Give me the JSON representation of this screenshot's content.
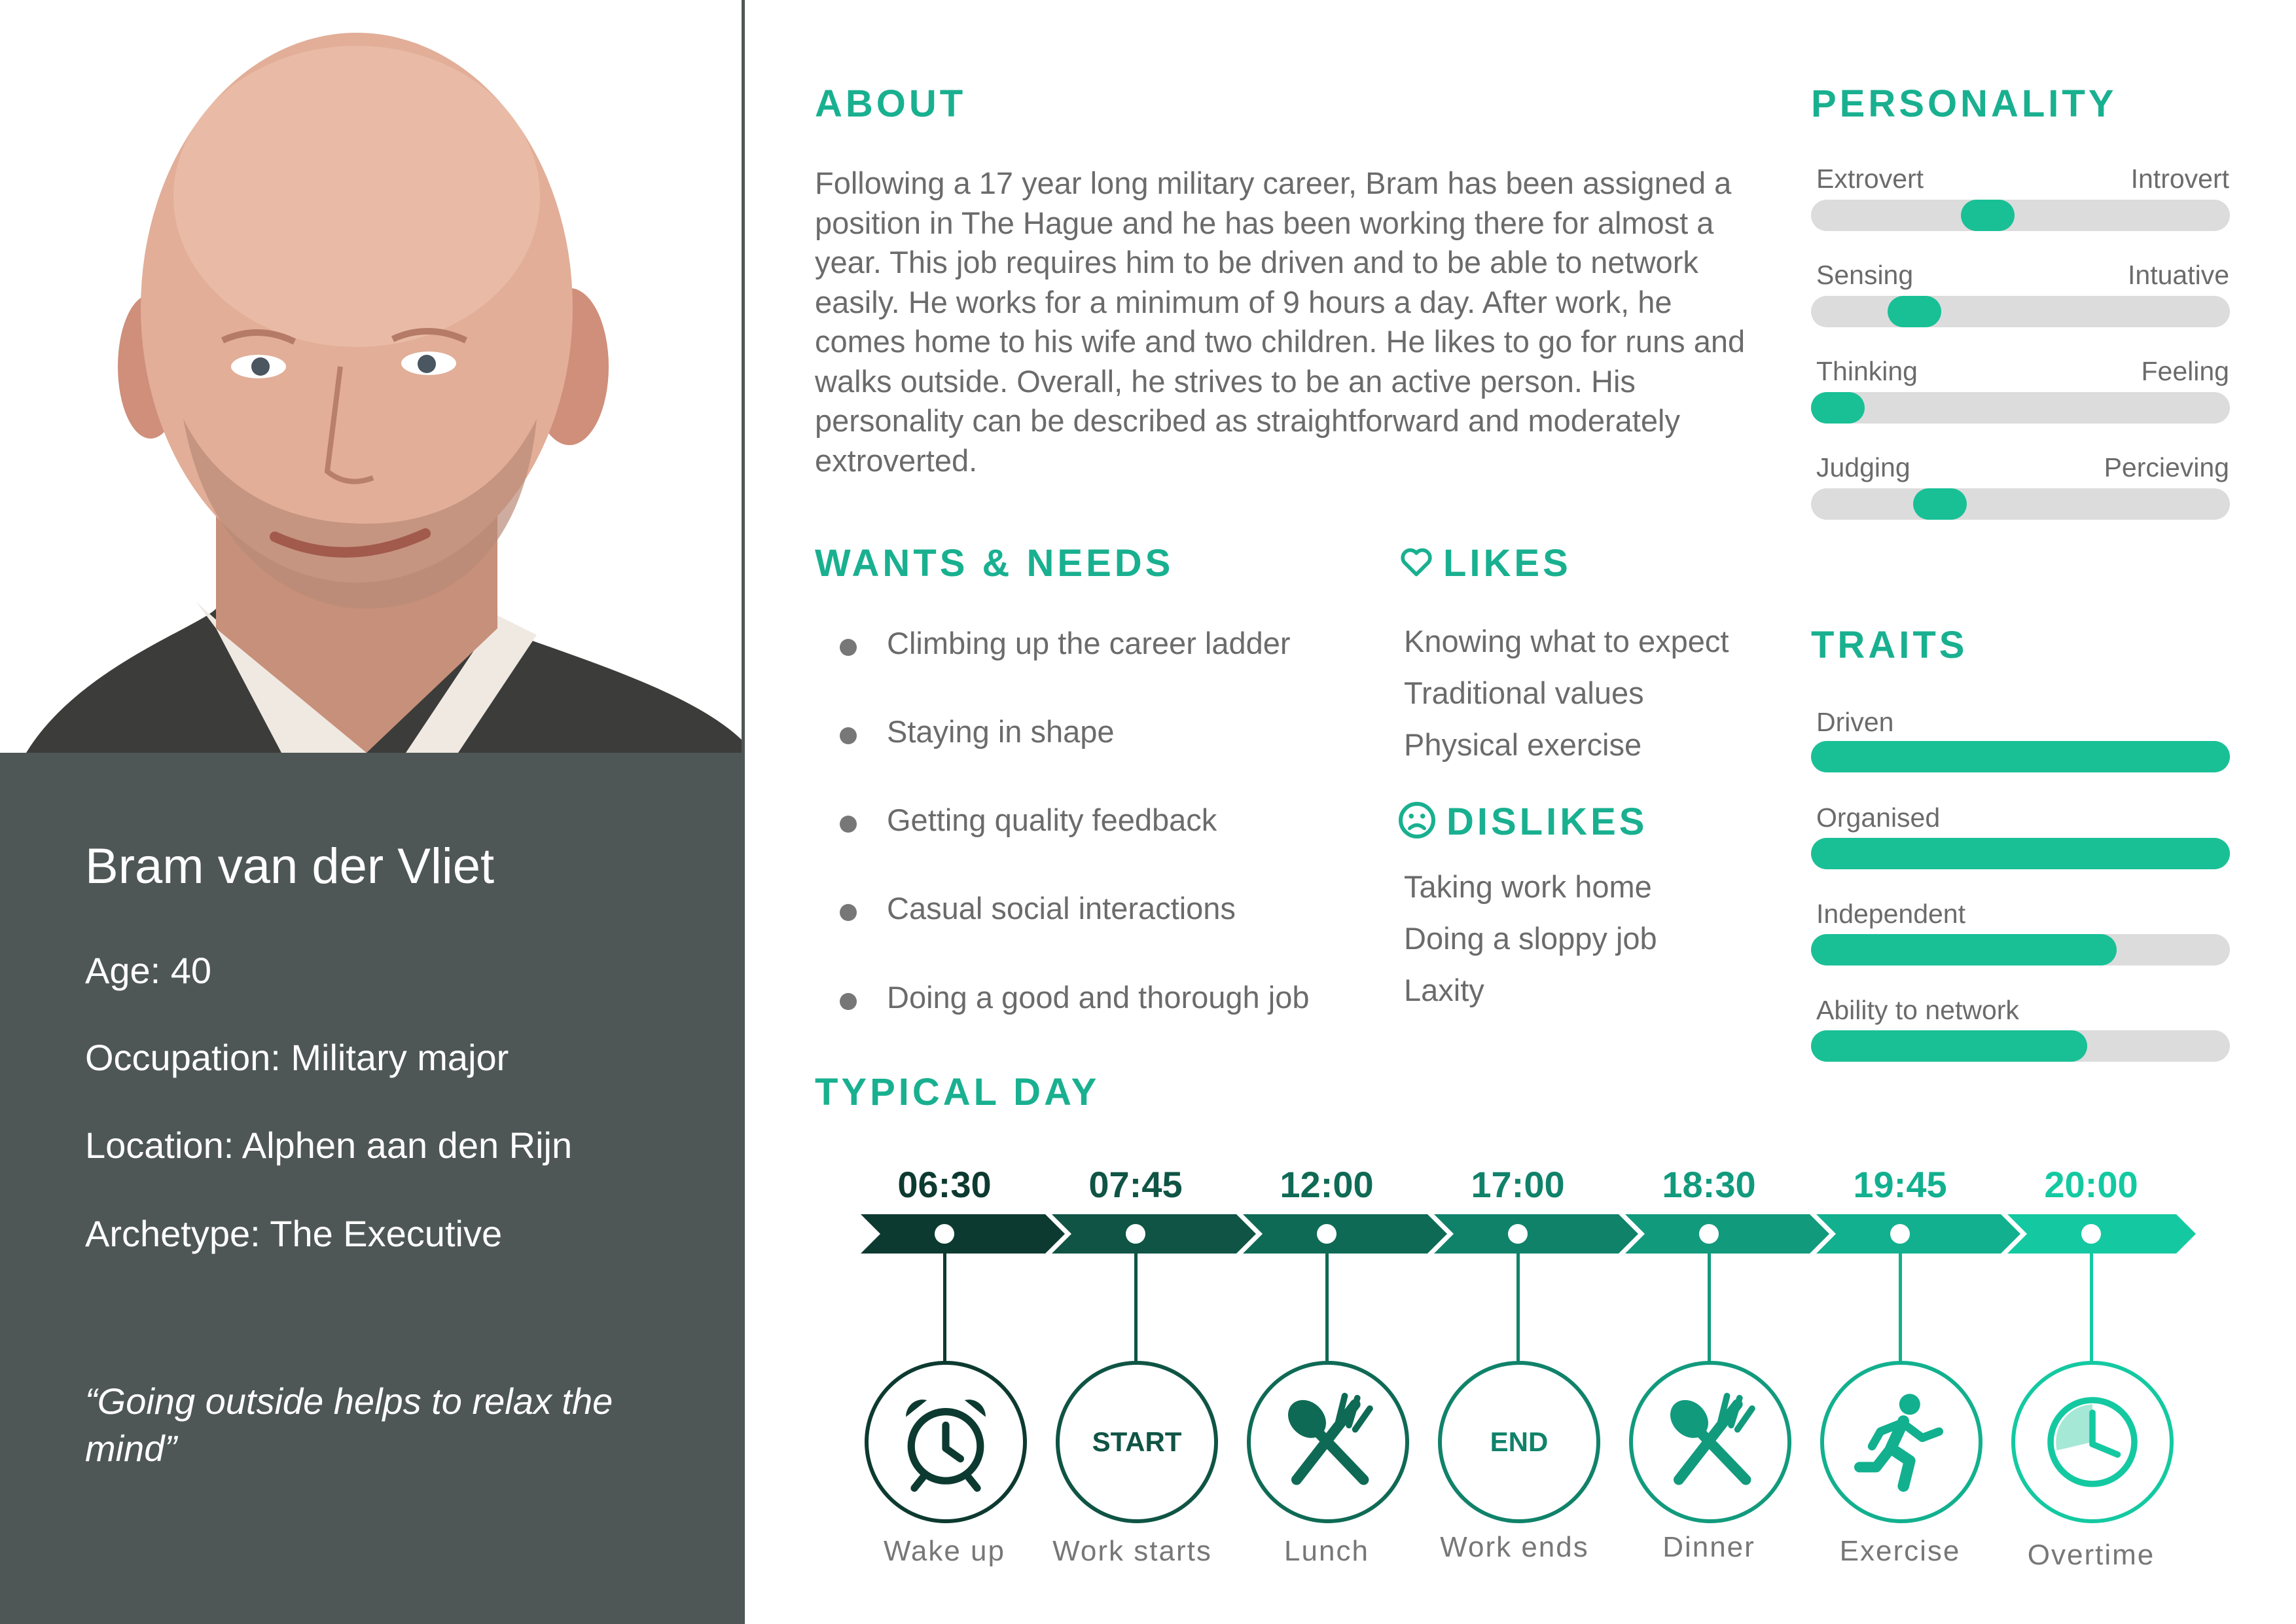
{
  "persona": {
    "name": "Bram van der Vliet",
    "age": "Age: 40",
    "occupation": "Occupation: Military major",
    "location": "Location: Alphen aan den Rijn",
    "archetype": "Archetype: The Executive",
    "quote": "“Going outside helps to relax the mind”"
  },
  "about": {
    "heading": "ABOUT",
    "text": "Following a 17 year long military career, Bram has been assigned a position in The Hague and he has been working there for almost a year. This job requires him to be driven and to be able to network easily. He works for a minimum of 9 hours a day. After work, he comes home to his wife and two children. He likes to go for runs and walks outside. Overall, he strives to be an active person. His personality can be described as straightforward and moderately extroverted."
  },
  "wants": {
    "heading": "WANTS & NEEDS",
    "items": [
      "Climbing up the career ladder",
      "Staying in shape",
      "Getting quality feedback",
      "Casual social interactions",
      "Doing a good and thorough job"
    ]
  },
  "likes": {
    "heading": "LIKES",
    "icon": "heart-icon",
    "items": [
      "Knowing what to expect",
      "Traditional values",
      "Physical exercise"
    ]
  },
  "dislikes": {
    "heading": "DISLIKES",
    "icon": "sad-face-icon",
    "items": [
      "Taking work home",
      "Doing a sloppy job",
      "Laxity"
    ]
  },
  "personality": {
    "heading": "PERSONALITY",
    "scales": [
      {
        "left": "Extrovert",
        "right": "Introvert",
        "position": 0.41
      },
      {
        "left": "Sensing",
        "right": "Intuative",
        "position": 0.21
      },
      {
        "left": "Thinking",
        "right": "Feeling",
        "position": 0.0
      },
      {
        "left": "Judging",
        "right": "Percieving",
        "position": 0.28
      }
    ]
  },
  "traits": {
    "heading": "TRAITS",
    "items": [
      {
        "label": "Driven",
        "level": 1.0
      },
      {
        "label": "Organised",
        "level": 1.0
      },
      {
        "label": "Independent",
        "level": 0.73
      },
      {
        "label": "Ability to network",
        "level": 0.66
      }
    ]
  },
  "typical_day": {
    "heading": "TYPICAL DAY",
    "events": [
      {
        "time": "06:30",
        "label": "Wake up",
        "icon": "alarm-clock-icon",
        "color": "#0d3a30"
      },
      {
        "time": "07:45",
        "label": "Work starts",
        "icon": "start-text-icon",
        "badge": "START",
        "color": "#0f5444"
      },
      {
        "time": "12:00",
        "label": "Lunch",
        "icon": "spoon-fork-icon",
        "color": "#0f6a55"
      },
      {
        "time": "17:00",
        "label": "Work ends",
        "icon": "end-text-icon",
        "badge": "END",
        "color": "#10826a"
      },
      {
        "time": "18:30",
        "label": "Dinner",
        "icon": "spoon-fork-icon",
        "color": "#129a7d"
      },
      {
        "time": "19:45",
        "label": "Exercise",
        "icon": "runner-icon",
        "color": "#12b08e"
      },
      {
        "time": "20:00",
        "label": "Overtime",
        "icon": "clock-icon",
        "color": "#14c9a1"
      }
    ]
  },
  "colors": {
    "accent": "#19b090",
    "panel": "#4e5755",
    "bar": "#19c096",
    "track": "#dcdcdc"
  }
}
